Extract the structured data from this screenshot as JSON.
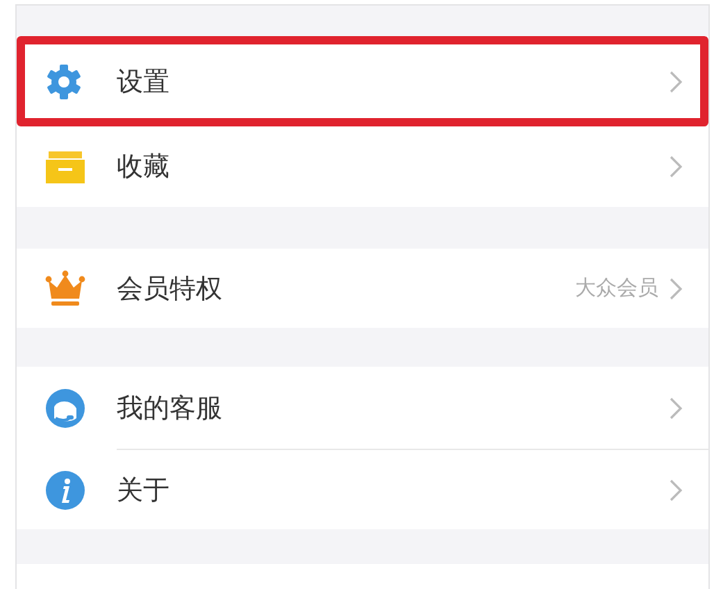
{
  "groups": [
    {
      "items": [
        {
          "label": "设置",
          "highlighted": true
        },
        {
          "label": "收藏",
          "highlighted": false
        }
      ]
    },
    {
      "items": [
        {
          "label": "会员特权",
          "value": "大众会员",
          "highlighted": false
        }
      ]
    },
    {
      "items": [
        {
          "label": "我的客服",
          "highlighted": false
        },
        {
          "label": "关于",
          "highlighted": false
        }
      ]
    }
  ]
}
